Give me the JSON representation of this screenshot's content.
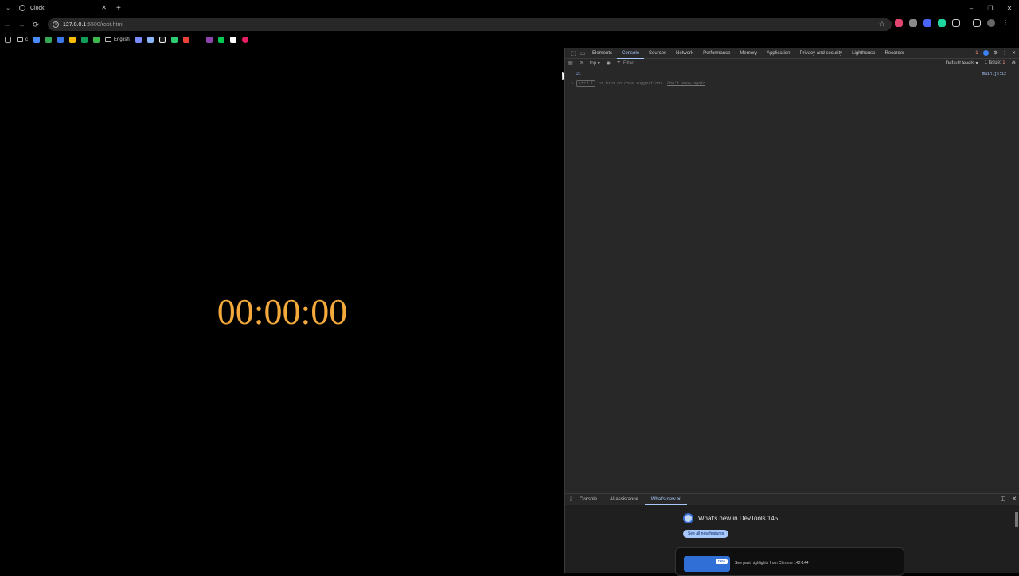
{
  "browser": {
    "tab_title": "Clock",
    "new_tab_symbol": "+",
    "close_symbol": "✕",
    "url_host": "127.0.0.1",
    "url_path": ":5500/root.html",
    "window_controls": [
      "–",
      "❐",
      "✕"
    ]
  },
  "bookmarks": {
    "folder1": "c",
    "folder2": "English",
    "icon_colors": [
      "#4a8cff",
      "#34a853",
      "#3b78e7",
      "#fbbc05",
      "#0f9d58",
      "#3dba4e",
      "#7c8aff",
      "#8ab4f8",
      "#1b1b1b",
      "#2ecc71",
      "#ea4335",
      "#8e44ad",
      "#00c853",
      "#ffffff",
      "#e91e63"
    ]
  },
  "page": {
    "clock_text": "00:00:00"
  },
  "devtools": {
    "tabs": [
      "Elements",
      "Console",
      "Sources",
      "Network",
      "Performance",
      "Memory",
      "Application",
      "Privacy and security",
      "Lighthouse",
      "Recorder"
    ],
    "selected_tab": "Console",
    "context": "top ▾",
    "filter_placeholder": "Filter",
    "levels": "Default levels ▾",
    "issues": "1 Issue:",
    "issues_count": "1",
    "error_count": "1",
    "console_line1": "21",
    "console_source": "main.js:12",
    "hint_key": "ctrl I",
    "hint_text": "to turn on code suggestions.",
    "hint_link": "Don't show again",
    "drawer_tabs": [
      "Console",
      "AI assistance",
      "What's new"
    ],
    "whats_new_title": "What's new in DevTools 145",
    "see_all_button": "See all new features",
    "card_badge": "new",
    "card_text": "See past highlights from Chrome 142-144"
  },
  "colors": {
    "clock": "#f4a93c",
    "devtools_bg": "#282828",
    "accent": "#a8c7fa"
  }
}
